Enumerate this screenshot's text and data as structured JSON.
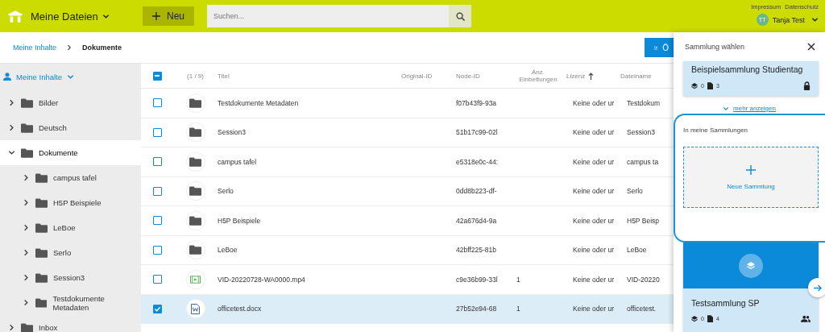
{
  "header": {
    "app_title": "Meine Dateien",
    "new_button": "Neu",
    "search": {
      "placeholder": "Suchen..."
    },
    "links": [
      "Impressum",
      "Datenschutz"
    ],
    "user": {
      "initials": "TT",
      "name": "Tanja Test"
    }
  },
  "breadcrumb": [
    {
      "label": "Meine Inhalte",
      "current": false
    },
    {
      "label": "Dokumente",
      "current": true
    }
  ],
  "action_button": "Ö",
  "sidebar": {
    "root": "Meine Inhalte",
    "items": [
      {
        "label": "Bilder",
        "expanded": false,
        "selected": false
      },
      {
        "label": "Deutsch",
        "expanded": false,
        "selected": false
      },
      {
        "label": "Dokumente",
        "expanded": true,
        "selected": true,
        "children": [
          {
            "label": "campus tafel",
            "expanded": false,
            "selected": false
          },
          {
            "label": "H5P Beispiele",
            "expanded": false,
            "selected": false
          },
          {
            "label": "LeBoe",
            "expanded": false,
            "selected": false
          },
          {
            "label": "Serlo",
            "expanded": false,
            "selected": false
          },
          {
            "label": "Session3",
            "expanded": false,
            "selected": false
          },
          {
            "label": "Testdokumente Metadaten",
            "expanded": false,
            "selected": false
          }
        ]
      },
      {
        "label": "Inbox",
        "expanded": false,
        "selected": false
      }
    ]
  },
  "table": {
    "some_selected": true,
    "count": "(1 / 9)",
    "columns": [
      {
        "label": "Titel",
        "sorted": false
      },
      {
        "label": "Original-ID",
        "sorted": false
      },
      {
        "label": "Node-ID",
        "sorted": false
      },
      {
        "label": "Anz. Einbettungen",
        "sorted": false
      },
      {
        "label": "Lizenz",
        "sorted": true
      },
      {
        "label": "Dateiname",
        "sorted": false
      }
    ],
    "rows": [
      {
        "kind": "folder",
        "checked": false,
        "cells": [
          "Testdokumente Metadaten",
          "",
          "f07b43f9-93a",
          "",
          "Keine oder ur",
          "Testdokum"
        ]
      },
      {
        "kind": "folder",
        "checked": false,
        "cells": [
          "Session3",
          "",
          "51b17c99-02l",
          "",
          "Keine oder ur",
          "Session3"
        ]
      },
      {
        "kind": "folder",
        "checked": false,
        "cells": [
          "campus tafel",
          "",
          "e5318e0c-44:",
          "",
          "Keine oder ur",
          "campus ta"
        ]
      },
      {
        "kind": "folder",
        "checked": false,
        "cells": [
          "Serlo",
          "",
          "0dd8b223-df-",
          "",
          "Keine oder ur",
          "Serlo"
        ]
      },
      {
        "kind": "folder",
        "checked": false,
        "cells": [
          "H5P Beispiele",
          "",
          "42a676d4-9a",
          "",
          "Keine oder ur",
          "H5P Beisp"
        ]
      },
      {
        "kind": "folder",
        "checked": false,
        "cells": [
          "LeBoe",
          "",
          "42bff225-81b",
          "",
          "Keine oder ur",
          "LeBoe"
        ]
      },
      {
        "kind": "video",
        "checked": false,
        "cells": [
          "VID-20220728-WA0000.mp4",
          "",
          "c9e36b99-33l",
          "1",
          "Keine oder ur",
          "VID-20220"
        ]
      },
      {
        "kind": "word",
        "checked": true,
        "cells": [
          "officetest.docx",
          "",
          "27b52e94-68",
          "1",
          "Keine oder ur",
          "officetest."
        ]
      }
    ]
  },
  "panel": {
    "title": "Sammlung wählen",
    "top_card": {
      "title": "Beispielsammlung Studientag",
      "collections": "0",
      "materials": "3",
      "locked": true
    },
    "more_link": "mehr anzeigen",
    "section_label": "In meine Sammlungen",
    "new_collection": "Neue Sammlung",
    "cards": [
      {
        "title": "Testsammlung SP",
        "collections": "0",
        "materials": "4",
        "shared": true
      }
    ]
  }
}
